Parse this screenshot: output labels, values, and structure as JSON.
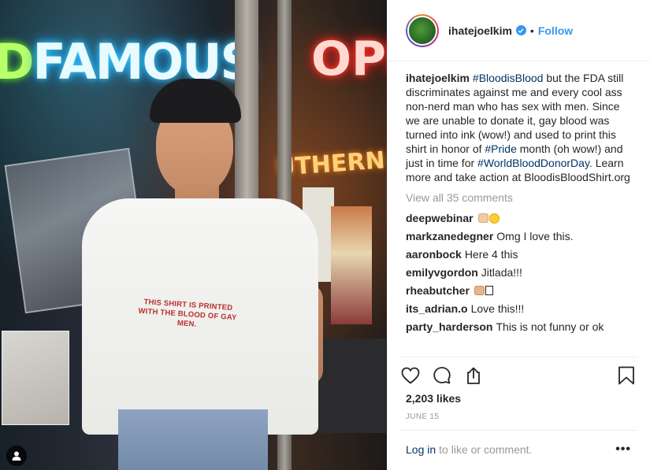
{
  "photo": {
    "shirt_text": "THIS SHIRT IS PRINTED WITH THE BLOOD OF GAY MEN.",
    "tag_button_icon": "person-tag-icon"
  },
  "header": {
    "username": "ihatejoelkim",
    "verified_icon": "verified-badge-icon",
    "separator": "•",
    "follow_label": "Follow"
  },
  "caption": {
    "username": "ihatejoelkim",
    "hashtag_1": "#BloodisBlood",
    "text_1": " but the FDA still discriminates against me and every cool ass non-nerd man who has sex with men. Since we are unable to donate it, gay blood was turned into ink (wow!) and used to print this shirt in honor of ",
    "hashtag_2": "#Pride",
    "text_2": " month (oh wow!) and just in time for ",
    "hashtag_3": "#WorldBloodDonorDay",
    "text_3": ". Learn more and take action at BloodisBloodShirt.org"
  },
  "view_all": "View all 35 comments",
  "comments": [
    {
      "user": "deepwebinar",
      "text": ""
    },
    {
      "user": "markzanedegner",
      "text": "Omg I love this."
    },
    {
      "user": "aaronbock",
      "text": "Here 4 this"
    },
    {
      "user": "emilyvgordon",
      "text": "Jitlada!!!"
    },
    {
      "user": "rheabutcher",
      "text": ""
    },
    {
      "user": "its_adrian.o",
      "text": "Love this!!!"
    },
    {
      "user": "party_harderson",
      "text": "This is not funny or ok"
    }
  ],
  "actions": {
    "like_icon": "heart-icon",
    "comment_icon": "comment-icon",
    "share_icon": "share-icon",
    "save_icon": "bookmark-icon"
  },
  "likes": "2,203 likes",
  "date": "JUNE 15",
  "footer": {
    "login_label": "Log in",
    "prompt": "to like or comment.",
    "more": "•••"
  },
  "colors": {
    "link": "#003569",
    "follow": "#3897f0",
    "muted": "#999999",
    "text": "#262626"
  }
}
